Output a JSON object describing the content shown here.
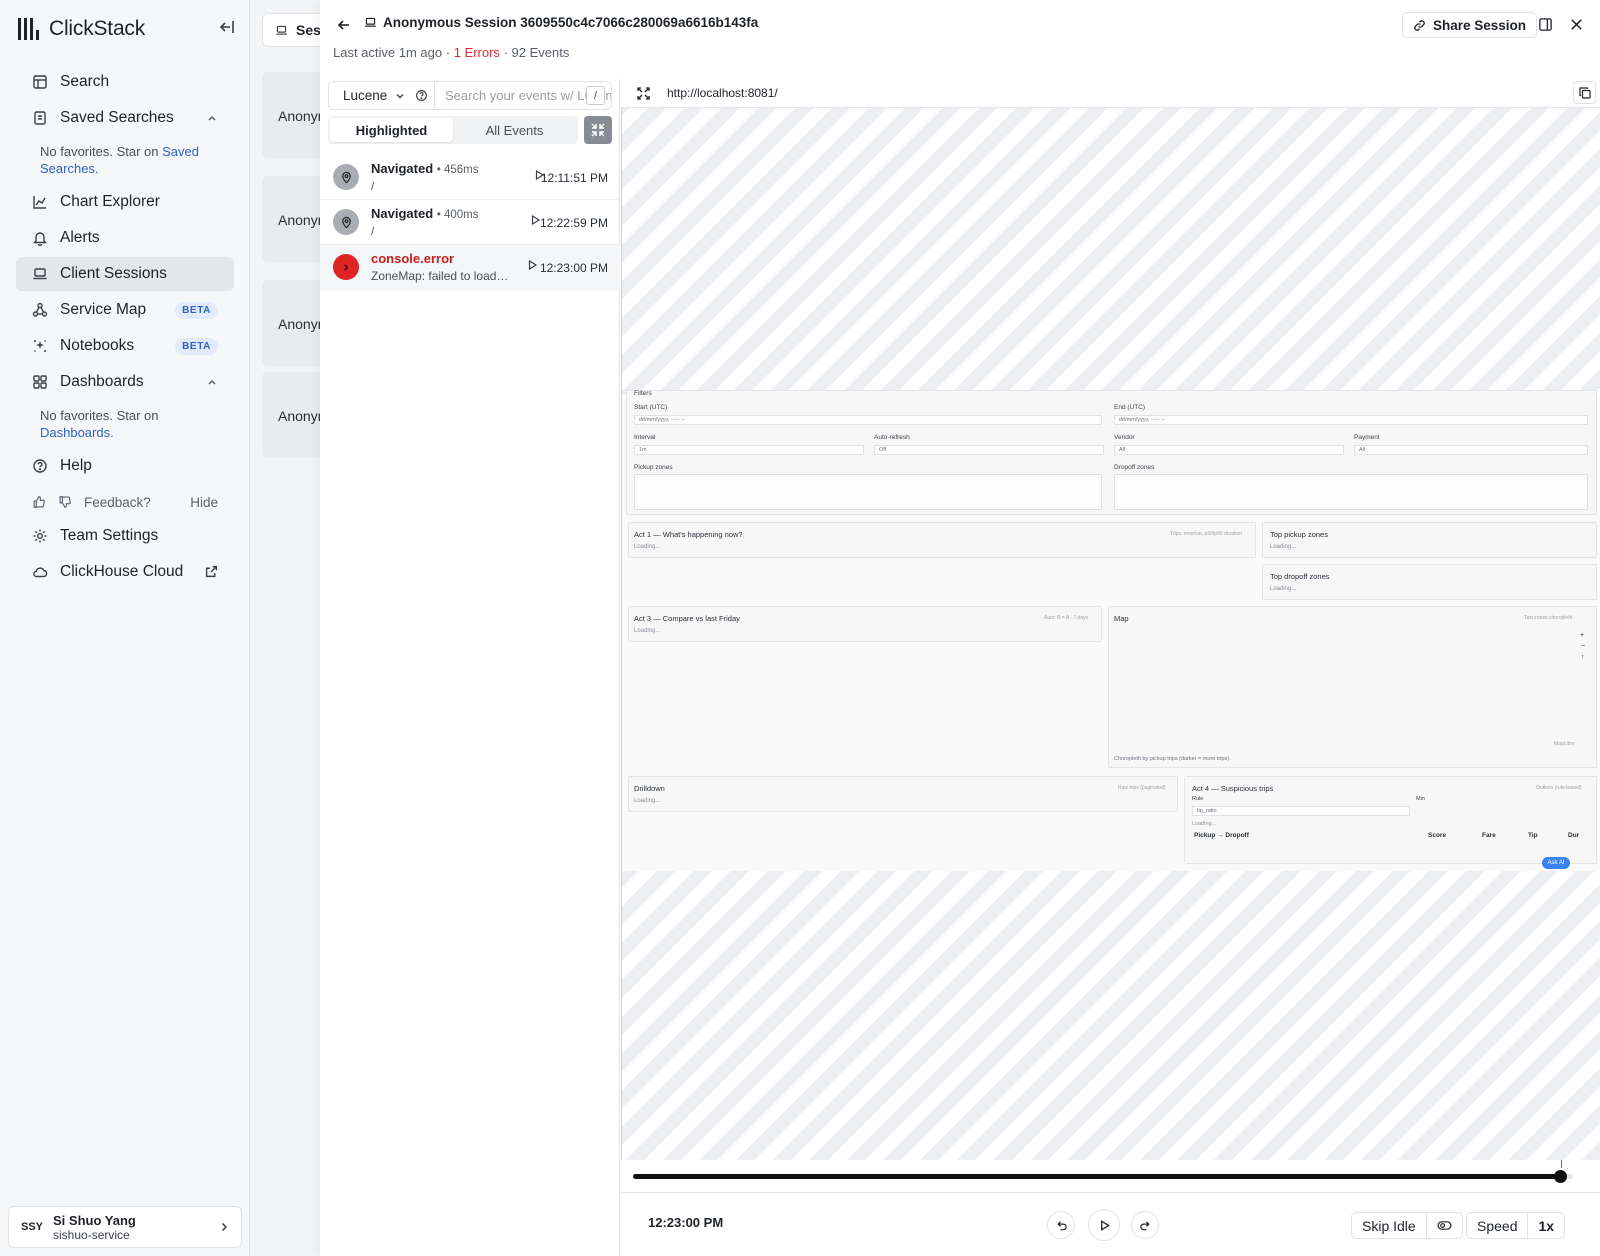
{
  "sidebar": {
    "brand": "ClickStack",
    "items": [
      {
        "label": "Search",
        "icon": "table-icon"
      },
      {
        "label": "Saved Searches",
        "icon": "bookmark-icon"
      },
      {
        "label": "Chart Explorer",
        "icon": "chart-icon"
      },
      {
        "label": "Alerts",
        "icon": "bell-icon"
      },
      {
        "label": "Client Sessions",
        "icon": "laptop-icon",
        "active": true
      },
      {
        "label": "Service Map",
        "icon": "graph-icon",
        "badge": "BETA"
      },
      {
        "label": "Notebooks",
        "icon": "sparkle-icon",
        "badge": "BETA"
      },
      {
        "label": "Dashboards",
        "icon": "grid-icon"
      },
      {
        "label": "Help",
        "icon": "help-icon"
      },
      {
        "label": "Team Settings",
        "icon": "gear-icon"
      },
      {
        "label": "ClickHouse Cloud",
        "icon": "cloud-icon"
      }
    ],
    "saved_note_prefix": "No favorites. Star on",
    "saved_note_link": "Saved Searches.",
    "dash_note_prefix": "No favorites. Star on",
    "dash_note_link": "Dashboards.",
    "feedback_label": "Feedback?",
    "feedback_hide": "Hide",
    "user": {
      "initials": "SSY",
      "name": "Si Shuo Yang",
      "team": "sishuo-service"
    }
  },
  "background": {
    "tab_label": "Ses",
    "cards": [
      "Anonym",
      "Anonym",
      "Anonym",
      "Anonym"
    ]
  },
  "session": {
    "title": "Anonymous Session 3609550c4c7066c280069a6616b143fa",
    "last_active": "Last active 1m ago",
    "errors": "1 Errors",
    "events": "92 Events",
    "share_label": "Share Session"
  },
  "events_panel": {
    "language": "Lucene",
    "search_placeholder": "Search your events w/ Lucene",
    "slash_key": "/",
    "tabs": [
      "Highlighted",
      "All Events"
    ],
    "rows": [
      {
        "title": "Navigated",
        "duration": "456ms",
        "sub": "/",
        "time": "12:11:51 PM",
        "kind": "nav"
      },
      {
        "title": "Navigated",
        "duration": "400ms",
        "sub": "/",
        "time": "12:22:59 PM",
        "kind": "nav"
      },
      {
        "title": "console.error",
        "duration": "",
        "sub": "ZoneMap: failed to load map",
        "time": "12:23:00 PM",
        "kind": "error"
      }
    ]
  },
  "player": {
    "url": "http://localhost:8081/",
    "progress": 0.986,
    "current_time": "12:23:00 PM",
    "skip_idle_label": "Skip Idle",
    "speed_label": "Speed",
    "speed_value": "1x"
  },
  "replay_page": {
    "filters_title": "Filters",
    "start_label": "Start (UTC)",
    "start_value": "dd/mm/yyyy, --:-- --",
    "end_label": "End (UTC)",
    "end_value": "dd/mm/yyyy, --:-- --",
    "interval_label": "Interval",
    "interval_value": "1m",
    "autorefresh_label": "Auto-refresh",
    "autorefresh_value": "Off",
    "vendor_label": "Vendor",
    "vendor_value": "All",
    "payment_label": "Payment",
    "payment_value": "All",
    "pickup_zones_label": "Pickup zones",
    "dropoff_zones_label": "Dropoff zones",
    "act1_title": "Act 1 — What's happening now?",
    "act1_right": "Trips, revenue, p50/p90 duration",
    "top_pickup_title": "Top pickup zones",
    "top_dropoff_title": "Top dropoff zones",
    "act3_title": "Act 3 — Compare vs last Friday",
    "act3_right": "Auto: B = A - 7 days",
    "map_title": "Map",
    "map_right": "Taxi zones choropleth",
    "map_caption": "Choropleth by pickup trips (darker = more trips).",
    "map_attrib": "MapLibre",
    "drilldown_title": "Drilldown",
    "drilldown_right": "Raw trips (paginated)",
    "act4_title": "Act 4 — Suspicious trips",
    "act4_right": "Outliers (rule-based)",
    "rule_label": "Rule",
    "rule_value": "tip_ratio",
    "min_label": "Min",
    "loading": "Loading...",
    "col_route": "Pickup → Dropoff",
    "col_score": "Score",
    "col_fare": "Fare",
    "col_tip": "Tip",
    "col_dur": "Dur",
    "ask_ai": "Ask AI"
  }
}
